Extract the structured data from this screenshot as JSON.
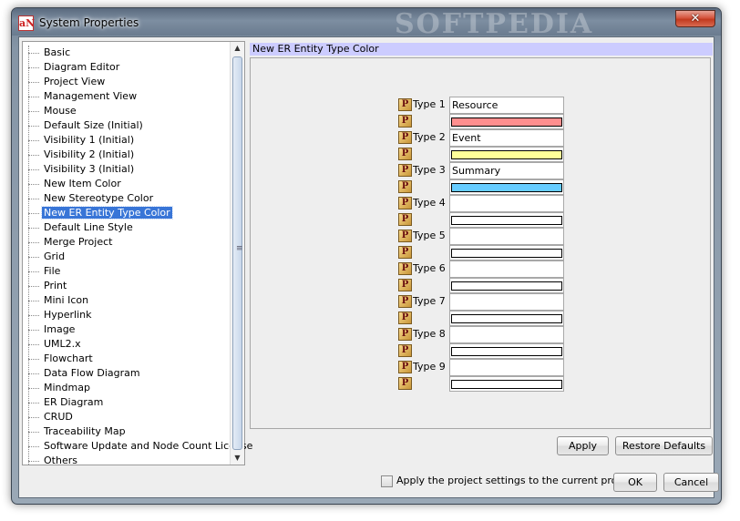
{
  "window": {
    "title": "System Properties",
    "app_icon_text": "aN",
    "watermark": "SOFTPEDIA",
    "close_label": "✕"
  },
  "tree": {
    "items": [
      {
        "label": "Basic"
      },
      {
        "label": "Diagram Editor"
      },
      {
        "label": "Project View"
      },
      {
        "label": "Management View"
      },
      {
        "label": "Mouse"
      },
      {
        "label": "Default Size (Initial)"
      },
      {
        "label": "Visibility 1 (Initial)"
      },
      {
        "label": "Visibility 2 (Initial)"
      },
      {
        "label": "Visibility 3 (Initial)"
      },
      {
        "label": "New Item Color"
      },
      {
        "label": "New Stereotype Color"
      },
      {
        "label": "New ER Entity Type Color",
        "selected": true
      },
      {
        "label": "Default Line Style"
      },
      {
        "label": "Merge Project"
      },
      {
        "label": "Grid"
      },
      {
        "label": "File"
      },
      {
        "label": "Print"
      },
      {
        "label": "Mini Icon"
      },
      {
        "label": "Hyperlink"
      },
      {
        "label": "Image"
      },
      {
        "label": "UML2.x"
      },
      {
        "label": "Flowchart"
      },
      {
        "label": "Data Flow Diagram"
      },
      {
        "label": "Mindmap"
      },
      {
        "label": "ER Diagram"
      },
      {
        "label": "CRUD"
      },
      {
        "label": "Traceability Map"
      },
      {
        "label": "Software Update and Node Count License"
      },
      {
        "label": "Others"
      }
    ]
  },
  "panel": {
    "header": "New ER Entity Type Color",
    "p_icon_text": "P",
    "types": [
      {
        "label": "Type 1",
        "name": "Resource",
        "color": "#ff8f8f"
      },
      {
        "label": "Type 2",
        "name": "Event",
        "color": "#ffff99"
      },
      {
        "label": "Type 3",
        "name": "Summary",
        "color": "#66ccff"
      },
      {
        "label": "Type 4",
        "name": "",
        "color": "#ffffff"
      },
      {
        "label": "Type 5",
        "name": "",
        "color": "#ffffff"
      },
      {
        "label": "Type 6",
        "name": "",
        "color": "#ffffff"
      },
      {
        "label": "Type 7",
        "name": "",
        "color": "#ffffff"
      },
      {
        "label": "Type 8",
        "name": "",
        "color": "#ffffff"
      },
      {
        "label": "Type 9",
        "name": "",
        "color": "#ffffff"
      }
    ]
  },
  "buttons": {
    "apply": "Apply",
    "restore": "Restore Defaults",
    "ok": "OK",
    "cancel": "Cancel"
  },
  "footer": {
    "checkbox_label": "Apply the project settings to the current project",
    "checkbox_checked": false
  }
}
